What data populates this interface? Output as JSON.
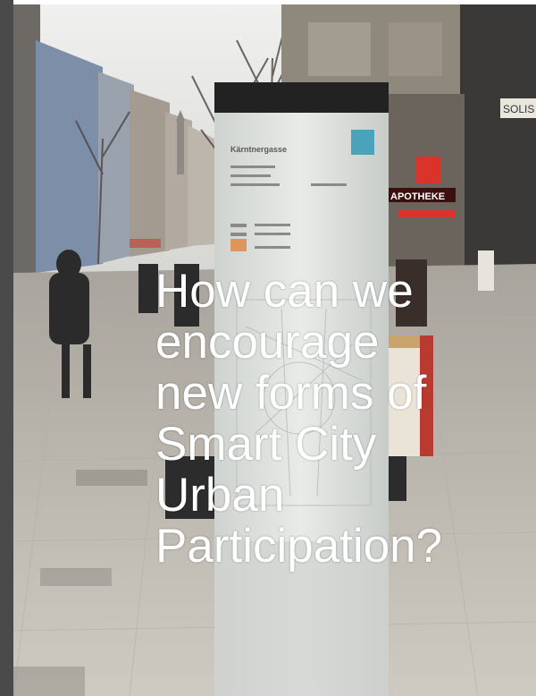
{
  "slide": {
    "caption": "How can we\nencourage\nnew forms of\nSmart City\nUrban\nParticipation?"
  },
  "photo": {
    "description_icon": "street-scene-photo",
    "colors": {
      "sky": "#e6e6e4",
      "pavement": "#c9c4bb",
      "building_left": "#7f8fa6",
      "building_right": "#8d8578",
      "sign_panel": "#dfe3e0",
      "sign_top": "#2a2a2a",
      "pharmacy_red": "#d9332b"
    }
  },
  "sign_text": {
    "street_name": "Kärntnergasse",
    "shop_sign": "APOTHEKE",
    "corner_sign": "SOLIS"
  }
}
